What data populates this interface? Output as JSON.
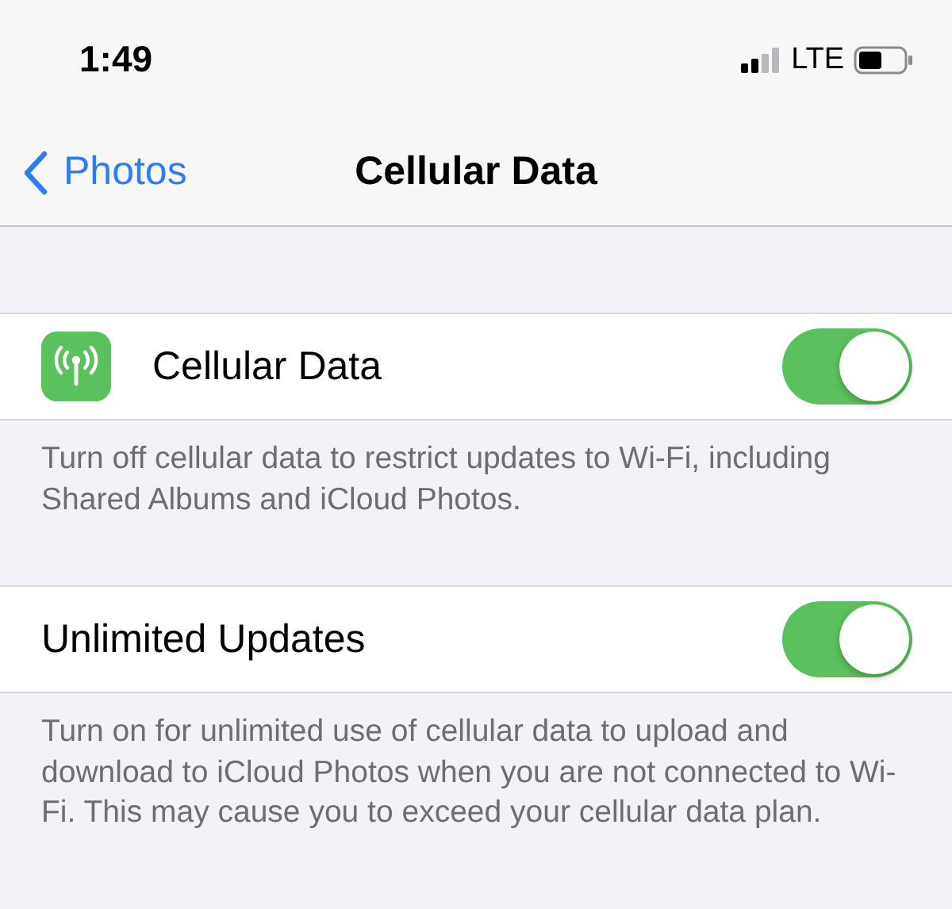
{
  "status_bar": {
    "time": "1:49",
    "network": "LTE"
  },
  "nav_bar": {
    "back": "Photos",
    "title": "Cellular Data"
  },
  "sections": [
    {
      "kind": "icon-toggle",
      "label": "Cellular Data",
      "on": true,
      "footer": "Turn off cellular data to restrict updates to Wi-Fi, including Shared Albums and iCloud Photos."
    },
    {
      "kind": "toggle",
      "label": "Unlimited Updates",
      "on": true,
      "footer": "Turn on for unlimited use of cellular data to upload and download to iCloud Photos when you are not connected to Wi-Fi. This may cause you to exceed your cellular data plan."
    }
  ]
}
